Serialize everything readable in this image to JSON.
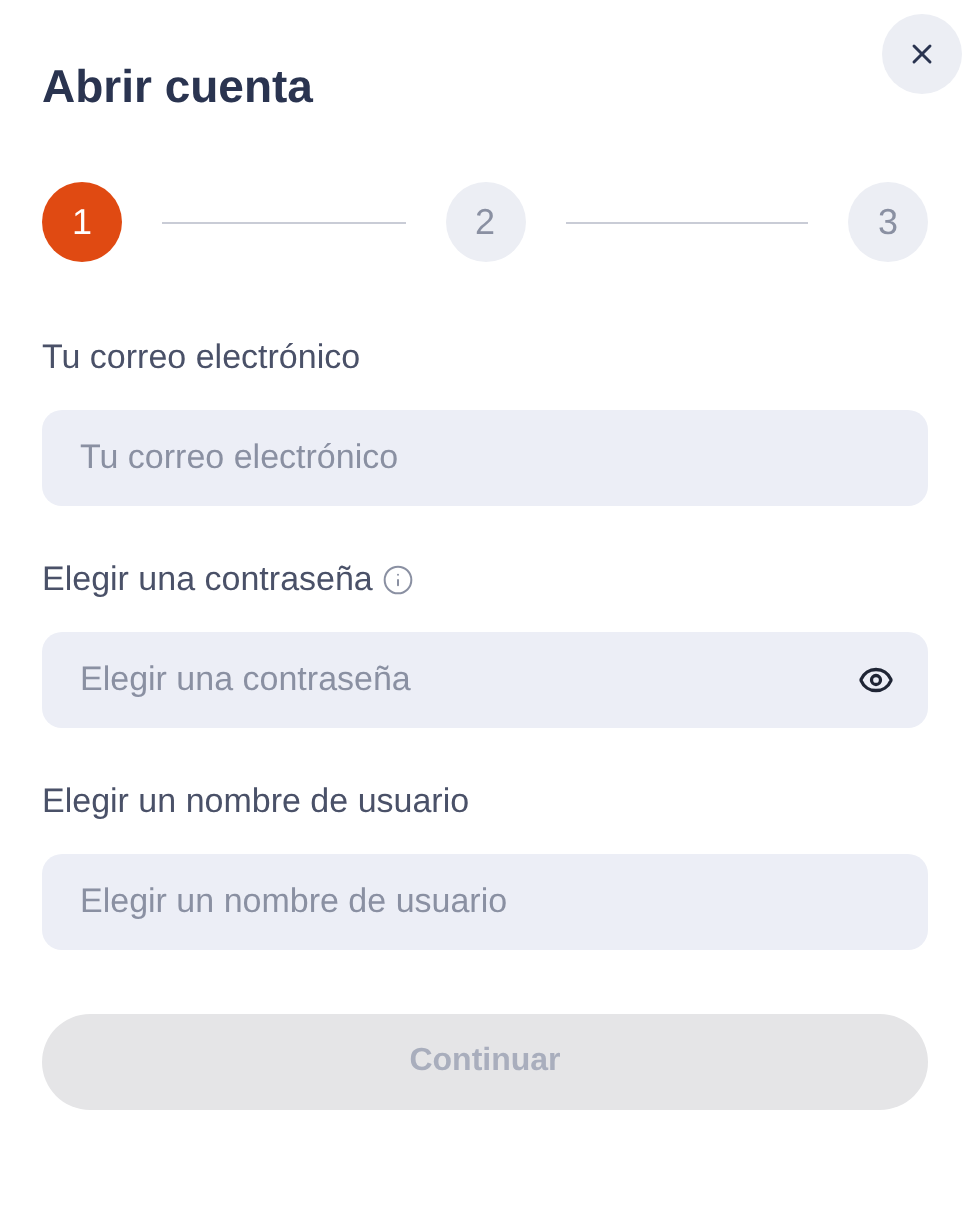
{
  "dialog": {
    "title": "Abrir cuenta"
  },
  "steps": [
    {
      "label": "1",
      "selected": true
    },
    {
      "label": "2",
      "selected": false
    },
    {
      "label": "3",
      "selected": false
    }
  ],
  "fields": [
    {
      "label": "Tu correo electrónico",
      "placeholder": "Tu correo electrónico",
      "kind": "text",
      "info": false
    },
    {
      "label": "Elegir una contraseña",
      "placeholder": "Elegir una contraseña",
      "kind": "password",
      "info": true
    },
    {
      "label": "Elegir un nombre de usuario",
      "placeholder": "Elegir un nombre de usuario",
      "kind": "text",
      "info": false
    }
  ],
  "submit": {
    "label": "Continuar",
    "disabled": true
  }
}
